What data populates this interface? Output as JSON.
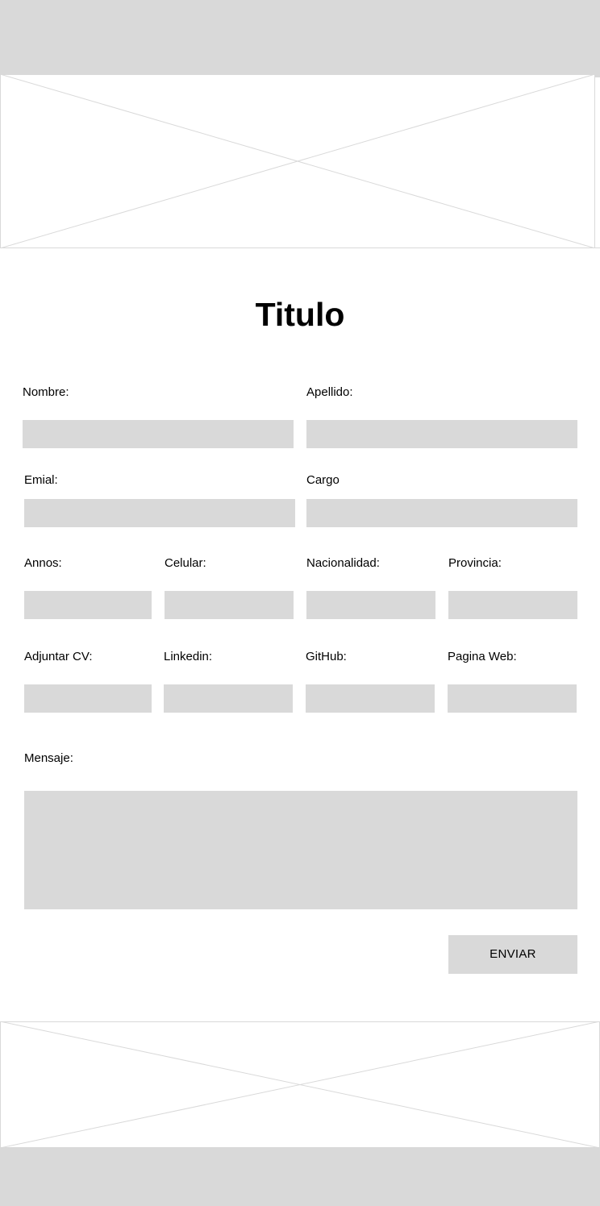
{
  "title": "Titulo",
  "colors": {
    "placeholder_fill": "#d9d9d9",
    "background": "#ffffff",
    "placeholder_line": "#d9d9d9"
  },
  "form": {
    "row1": {
      "nombre_label": "Nombre:",
      "apellido_label": "Apellido:"
    },
    "row2": {
      "email_label": "Emial:",
      "cargo_label": "Cargo"
    },
    "row3": {
      "annos_label": "Annos:",
      "celular_label": "Celular:",
      "nacionalidad_label": "Nacionalidad:",
      "provincia_label": "Provincia:"
    },
    "row4": {
      "cv_label": "Adjuntar CV:",
      "linkedin_label": "Linkedin:",
      "github_label": "GitHub:",
      "web_label": "Pagina Web:"
    },
    "mensaje_label": "Mensaje:",
    "submit_label": "ENVIAR"
  },
  "images": {
    "hero": "image-placeholder",
    "footer": "image-placeholder"
  }
}
